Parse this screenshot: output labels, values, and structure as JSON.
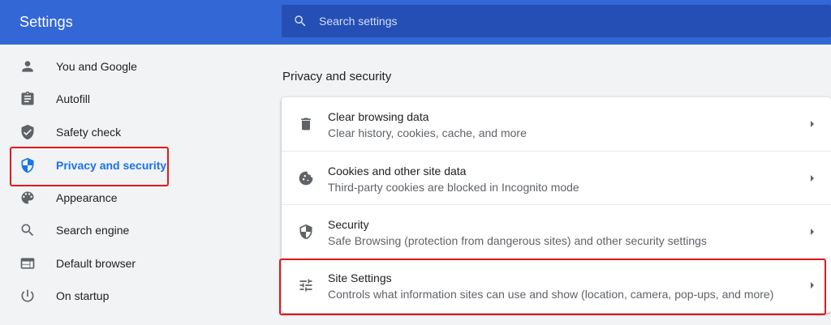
{
  "header": {
    "title": "Settings",
    "search_placeholder": "Search settings",
    "search_icon": "search-icon"
  },
  "sidebar": {
    "items": [
      {
        "label": "You and Google",
        "icon": "person-icon"
      },
      {
        "label": "Autofill",
        "icon": "clipboard-icon"
      },
      {
        "label": "Safety check",
        "icon": "shield-check-icon"
      },
      {
        "label": "Privacy and security",
        "icon": "shield-icon",
        "active": true
      },
      {
        "label": "Appearance",
        "icon": "palette-icon"
      },
      {
        "label": "Search engine",
        "icon": "search-icon"
      },
      {
        "label": "Default browser",
        "icon": "browser-icon"
      },
      {
        "label": "On startup",
        "icon": "power-icon"
      }
    ]
  },
  "main": {
    "section_title": "Privacy and security",
    "rows": [
      {
        "title": "Clear browsing data",
        "subtitle": "Clear history, cookies, cache, and more",
        "icon": "trash-icon"
      },
      {
        "title": "Cookies and other site data",
        "subtitle": "Third-party cookies are blocked in Incognito mode",
        "icon": "cookie-icon"
      },
      {
        "title": "Security",
        "subtitle": "Safe Browsing (protection from dangerous sites) and other security settings",
        "icon": "shield-icon"
      },
      {
        "title": "Site Settings",
        "subtitle": "Controls what information sites can use and show (location, camera, pop-ups, and more)",
        "icon": "sliders-icon"
      }
    ]
  },
  "colors": {
    "header_bg": "#3367d6",
    "search_bg": "#254fb5",
    "active": "#1a73e8",
    "icon": "#5f6368",
    "highlight": "#e3191b"
  }
}
